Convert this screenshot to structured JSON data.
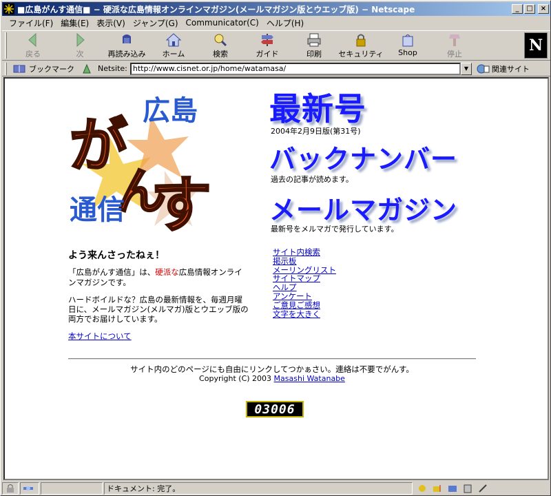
{
  "window": {
    "title": "■広島がんす通信■ − 硬派な広島情報オンラインマガジン(メールマガジン版とウエッブ版) − Netscape"
  },
  "menu": [
    "ファイル(F)",
    "編集(E)",
    "表示(V)",
    "ジャンプ(G)",
    "Communicator(C)",
    "ヘルプ(H)"
  ],
  "toolbar": {
    "back": "戻る",
    "forward": "次",
    "reload": "再読み込み",
    "home": "ホーム",
    "search": "検索",
    "guide": "ガイド",
    "print": "印刷",
    "security": "セキュリティ",
    "shop": "Shop",
    "stop": "停止",
    "logo": "N"
  },
  "location": {
    "bookmarks": "ブックマーク",
    "netsite_label": "Netsite:",
    "url": "http://www.cisnet.or.jp/home/watamasa/",
    "related": "関連サイト"
  },
  "page": {
    "logo_text": {
      "hiroshima": "広島",
      "gansu": "がんす",
      "tsushin": "通信"
    },
    "latest_heading": "最新号",
    "latest_sub": "2004年2月9日版(第31号)",
    "back_heading": "バックナンバー",
    "back_sub": "過去の記事が読めます。",
    "mail_heading": "メールマガジン",
    "mail_sub": "最新号をメルマガで発行しています。",
    "welcome": "よう来んさったねぇ！",
    "intro_pre": "「広島がんす通信」は、",
    "intro_red": "硬派な",
    "intro_post": "広島情報オンラインマガジンです。",
    "intro2": "ハードボイルドな？広島の最新情報を、毎週月曜日に、メールマガジン(メルマガ)版とウエッブ版の両方でお届けしています。",
    "about_link": "本サイトについて",
    "links": [
      "サイト内検索",
      "掲示板",
      "メーリングリスト",
      "サイトマップ",
      "ヘルプ",
      "アンケート",
      "ご意見ご感想",
      "文字を大きく"
    ],
    "footer_line1": "サイト内のどのページにも自由にリンクしてつかぁさい。連絡は不要でがんす。",
    "footer_copyright": "Copyright (C) 2003",
    "footer_author": "Masashi Watanabe",
    "counter": "03006"
  },
  "status": {
    "text": "ドキュメント: 完了。"
  }
}
